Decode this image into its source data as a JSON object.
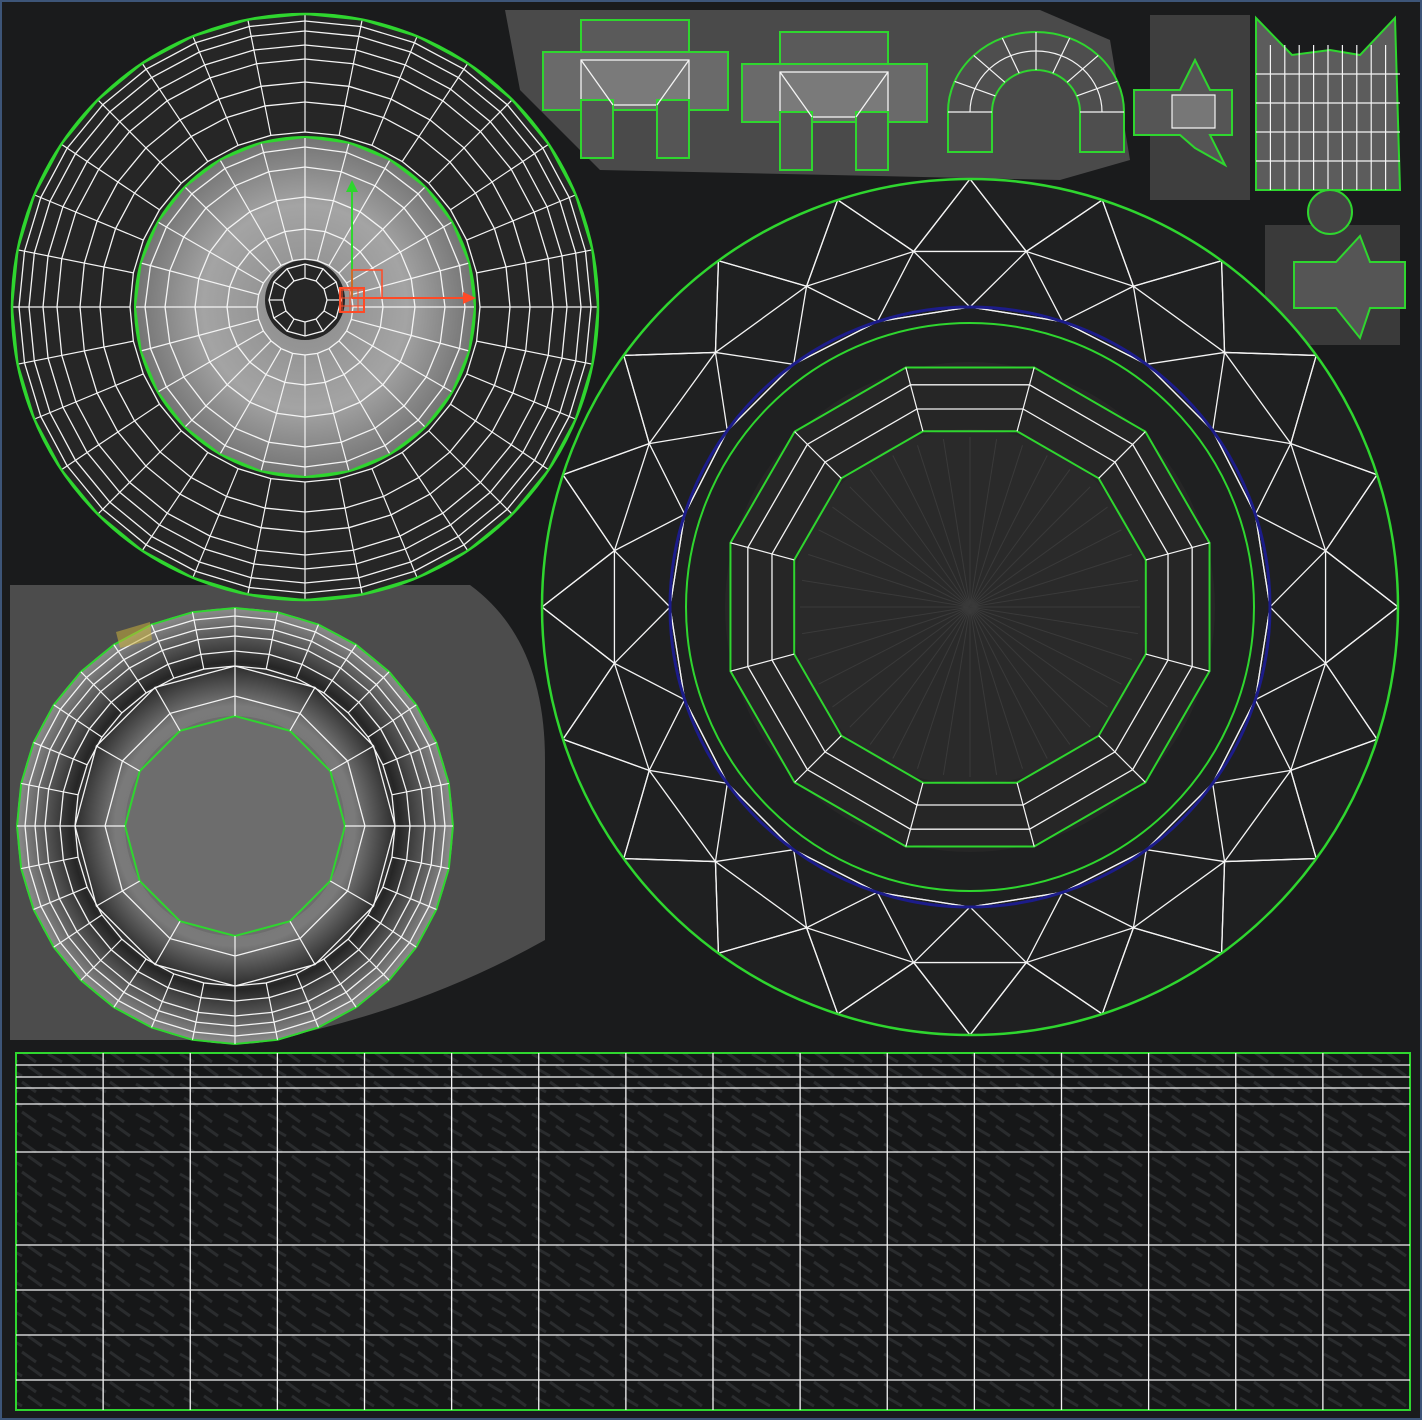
{
  "editor": {
    "view_name": "uv-editor-viewport",
    "colors": {
      "background": "#1a1b1c",
      "frame": "#3d5578",
      "island_border": "#2fd62f",
      "wire": "#f4f4f4",
      "selection_seam": "#1c1c8a",
      "gizmo_x": "#ff4a26",
      "gizmo_y": "#2ed62e",
      "selected_face": "#c9b13a"
    },
    "gizmo": {
      "axes": [
        "x-axis",
        "y-axis"
      ],
      "icon": "move-transform-gizmo-icon"
    },
    "islands": [
      {
        "id": "hubcap-island",
        "icon": "uv-island-icon"
      },
      {
        "id": "rim-face-island",
        "icon": "uv-island-icon"
      },
      {
        "id": "tire-sidewall-island",
        "icon": "uv-island-icon"
      },
      {
        "id": "tread-strip-island",
        "icon": "uv-island-icon"
      },
      {
        "id": "small-parts-islands",
        "icon": "uv-island-icon"
      }
    ]
  }
}
